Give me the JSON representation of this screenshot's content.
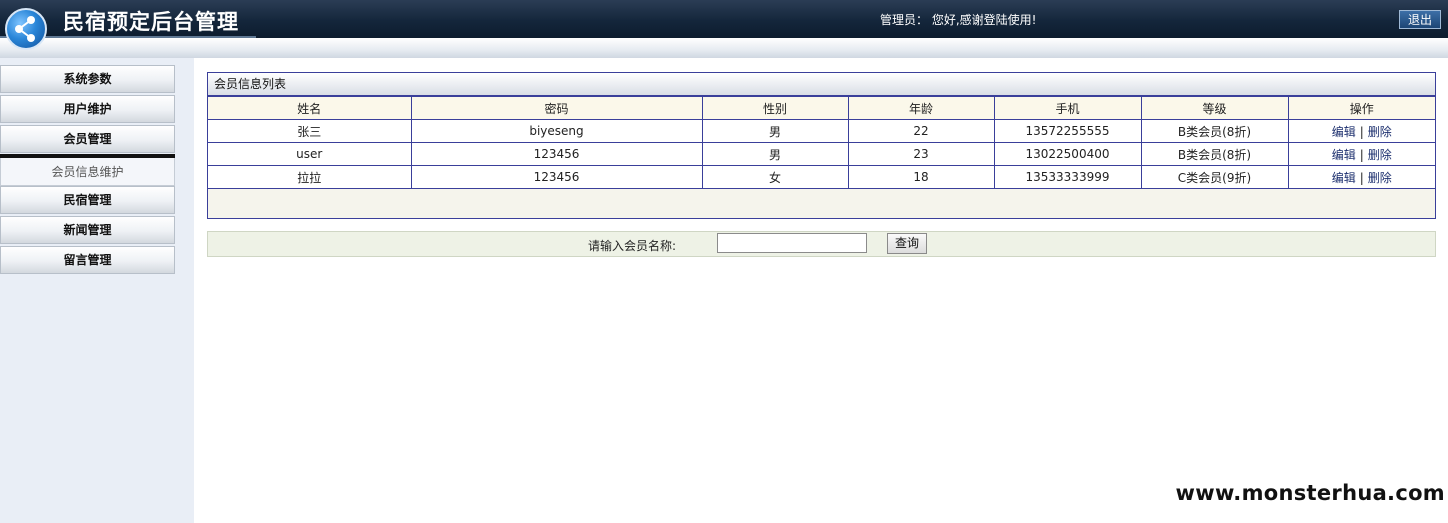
{
  "header": {
    "title": "民宿预定后台管理",
    "greeting": "管理员：  您好,感谢登陆使用!",
    "logout_label": "退出"
  },
  "sidebar": {
    "items": [
      {
        "label": "系统参数"
      },
      {
        "label": "用户维护"
      },
      {
        "label": "会员管理"
      },
      {
        "label": "民宿管理"
      },
      {
        "label": "新闻管理"
      },
      {
        "label": "留言管理"
      }
    ],
    "active_sub_item": "会员信息维护"
  },
  "panel": {
    "title": "会员信息列表",
    "columns": [
      "姓名",
      "密码",
      "性别",
      "年龄",
      "手机",
      "等级",
      "操作"
    ],
    "rows": [
      {
        "name": "张三",
        "password": "biyeseng",
        "gender": "男",
        "age": "22",
        "phone": "13572255555",
        "level": "B类会员(8折)",
        "edit": "编辑",
        "sep": "|",
        "delete": "删除"
      },
      {
        "name": "user",
        "password": "123456",
        "gender": "男",
        "age": "23",
        "phone": "13022500400",
        "level": "B类会员(8折)",
        "edit": "编辑",
        "sep": "|",
        "delete": "删除"
      },
      {
        "name": "拉拉",
        "password": "123456",
        "gender": "女",
        "age": "18",
        "phone": "13533333999",
        "level": "C类会员(9折)",
        "edit": "编辑",
        "sep": "|",
        "delete": "删除"
      }
    ]
  },
  "search": {
    "label": "请输入会员名称:",
    "value": "",
    "button_label": "查询"
  },
  "watermark": "www.monsterhua.com"
}
